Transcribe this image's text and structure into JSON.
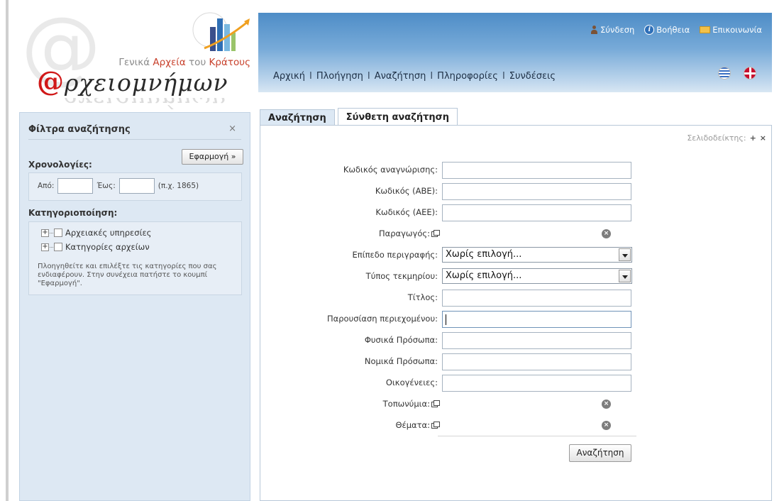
{
  "logo": {
    "org_part1": "Γενικά ",
    "org_part2": "Αρχεία",
    "org_part3": " του ",
    "org_part4": "Κράτους",
    "brand_mark": "@",
    "brand_text": "ρχειομνήμων"
  },
  "header": {
    "top_links": [
      {
        "label": "Σύνδεση",
        "icon": "user-icon"
      },
      {
        "label": "Βοήθεια",
        "icon": "help-icon"
      },
      {
        "label": "Επικοινωνία",
        "icon": "mail-icon"
      }
    ],
    "nav": [
      "Αρχική",
      "Πλοήγηση",
      "Αναζήτηση",
      "Πληροφορίες",
      "Συνδέσεις"
    ],
    "nav_separator": "I",
    "languages": [
      "greek-flag-icon",
      "uk-flag-icon"
    ]
  },
  "sidebar": {
    "title": "Φίλτρα αναζήτησης",
    "close": "×",
    "apply_button": "Εφαρμογή »",
    "dates_heading": "Χρονολογίες:",
    "from_label": "Από:",
    "to_label": "Έως:",
    "date_hint": "(π.χ. 1865)",
    "categorization_heading": "Κατηγοριοποίηση:",
    "tree": [
      "Αρχειακές υπηρεσίες",
      "Κατηγορίες αρχείων"
    ],
    "help_text": "Πλοηγηθείτε και επιλέξτε τις κατηγορίες που σας ενδιαφέρουν. Στην συνέχεια πατήστε το κουμπί \"Εφαρμογή\"."
  },
  "tabs": [
    "Αναζήτηση",
    "Σύνθετη αναζήτηση"
  ],
  "bookmarks": {
    "label": "Σελιδοδείκτης:",
    "add": "+",
    "remove": "×"
  },
  "form": {
    "fields": [
      {
        "label": "Κωδικός αναγνώρισης:",
        "type": "text",
        "value": ""
      },
      {
        "label": "Κωδικός (ΑΒΕ):",
        "type": "text",
        "value": ""
      },
      {
        "label": "Κωδικός (ΑΕΕ):",
        "type": "text",
        "value": ""
      },
      {
        "label": "Παραγωγός:",
        "type": "picker"
      },
      {
        "label": "Επίπεδο περιγραφής:",
        "type": "select",
        "value": "Χωρίς επιλογή..."
      },
      {
        "label": "Τύπος τεκμηρίου:",
        "type": "select",
        "value": "Χωρίς επιλογή..."
      },
      {
        "label": "Τίτλος:",
        "type": "text",
        "value": ""
      },
      {
        "label": "Παρουσίαση περιεχομένου:",
        "type": "text",
        "value": ""
      },
      {
        "label": "Φυσικά Πρόσωπα:",
        "type": "text",
        "value": ""
      },
      {
        "label": "Νομικά Πρόσωπα:",
        "type": "text",
        "value": ""
      },
      {
        "label": "Οικογένειες:",
        "type": "text",
        "value": ""
      },
      {
        "label": "Τοπωνύμια:",
        "type": "picker"
      },
      {
        "label": "Θέματα:",
        "type": "picker"
      }
    ],
    "search_button": "Αναζήτηση"
  }
}
